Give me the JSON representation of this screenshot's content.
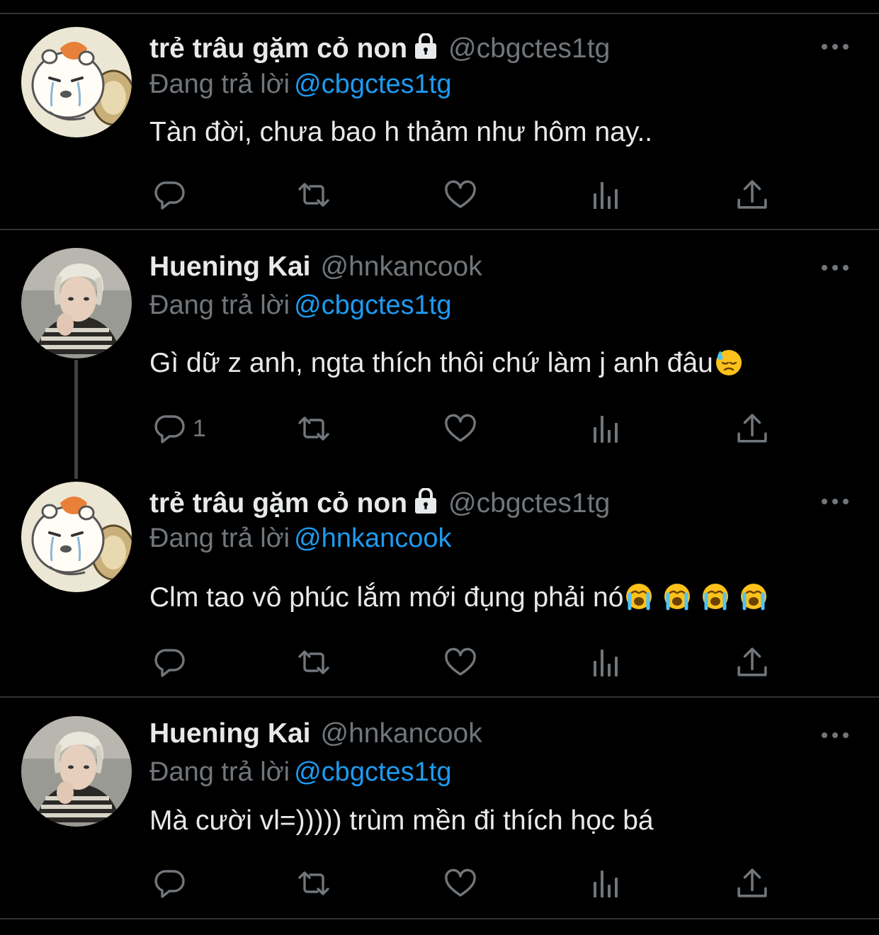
{
  "tweets": [
    {
      "name": "trẻ trâu gặm cỏ non",
      "handle": "@cbgctes1tg",
      "protected": true,
      "avatar_icon": "hamster-avatar",
      "replying_label": "Đang trả lời",
      "replying_to": "@cbgctes1tg",
      "text": "Tàn đời, chưa bao h thảm như hôm nay..",
      "emojis": [],
      "reply_count": ""
    },
    {
      "name": "Huening Kai",
      "handle": "@hnkancook",
      "protected": false,
      "avatar_icon": "person-photo-avatar",
      "replying_label": "Đang trả lời",
      "replying_to": "@cbgctes1tg",
      "text": "Gì dữ z anh, ngta thích thôi chứ làm j anh đâu",
      "emojis": [
        "downcast-sweat-emoji"
      ],
      "reply_count": "1"
    },
    {
      "name": "trẻ trâu gặm cỏ non",
      "handle": "@cbgctes1tg",
      "protected": true,
      "avatar_icon": "hamster-avatar",
      "replying_label": "Đang trả lời",
      "replying_to": "@hnkancook",
      "text": "Clm tao vô phúc lắm mới đụng phải nó",
      "emojis": [
        "loudly-crying-emoji",
        "loudly-crying-emoji",
        "loudly-crying-emoji",
        "loudly-crying-emoji"
      ],
      "reply_count": ""
    },
    {
      "name": "Huening Kai",
      "handle": "@hnkancook",
      "protected": false,
      "avatar_icon": "person-photo-avatar",
      "replying_label": "Đang trả lời",
      "replying_to": "@cbgctes1tg",
      "text": "Mà cười vl=))))) trùm mền đi thích học bá",
      "emojis": [],
      "reply_count": ""
    }
  ],
  "action_icons": [
    "reply-icon",
    "retweet-icon",
    "like-icon",
    "views-icon",
    "share-icon"
  ],
  "colors": {
    "background": "#000000",
    "text": "#e7e9ea",
    "secondary": "#71767b",
    "link": "#1d9bf0",
    "divider": "#2f3336"
  }
}
